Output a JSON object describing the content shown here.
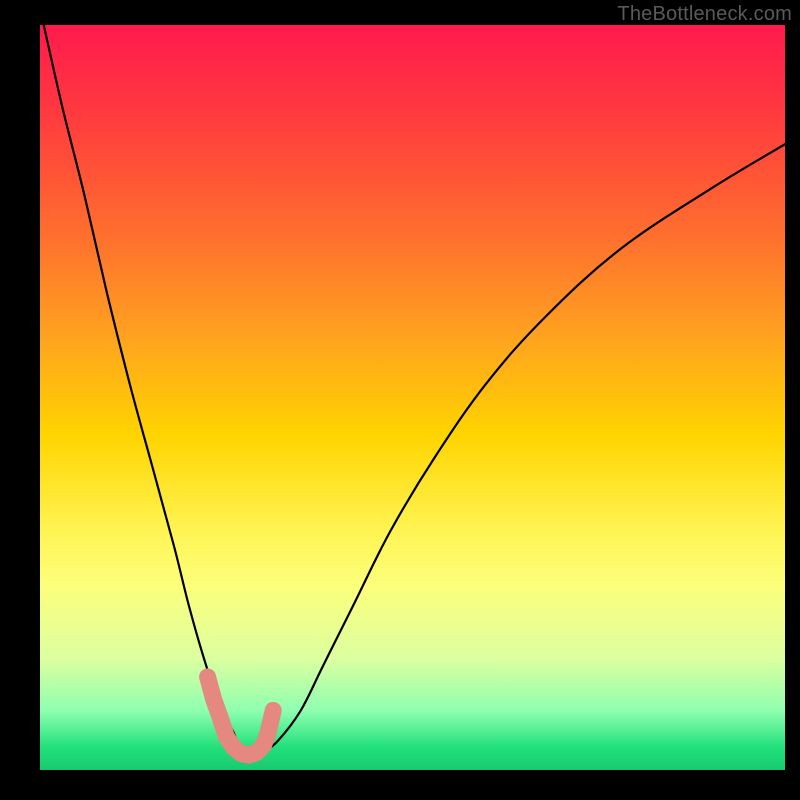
{
  "watermark": "TheBottleneck.com",
  "chart_data": {
    "type": "line",
    "title": "",
    "xlabel": "",
    "ylabel": "",
    "xlim": [
      0,
      100
    ],
    "ylim": [
      0,
      100
    ],
    "series": [
      {
        "name": "bottleneck-curve",
        "x": [
          0.5,
          3,
          6,
          9,
          12,
          15,
          18,
          20,
          22,
          24,
          26,
          27,
          28.5,
          30,
          32,
          35,
          38,
          42,
          47,
          53,
          60,
          68,
          78,
          90,
          100
        ],
        "values": [
          100,
          89,
          77,
          64,
          52,
          41,
          30,
          22,
          15,
          9,
          5,
          3,
          2,
          2.5,
          4,
          8,
          14,
          22,
          32,
          42,
          52,
          61,
          70,
          78,
          84
        ]
      },
      {
        "name": "highlight-segment",
        "x": [
          22.5,
          23.3,
          24.2,
          25.0,
          26.0,
          27.0,
          28.0,
          29.0,
          30.0,
          30.6,
          31.3
        ],
        "values": [
          12.5,
          9.5,
          7.0,
          4.5,
          3.0,
          2.2,
          2.0,
          2.3,
          3.3,
          5.0,
          8.0
        ]
      }
    ],
    "colors": {
      "curve": "#000000",
      "highlight": "#e48880",
      "gradient_top": "#ff1a4d",
      "gradient_bottom": "#19c970"
    }
  }
}
